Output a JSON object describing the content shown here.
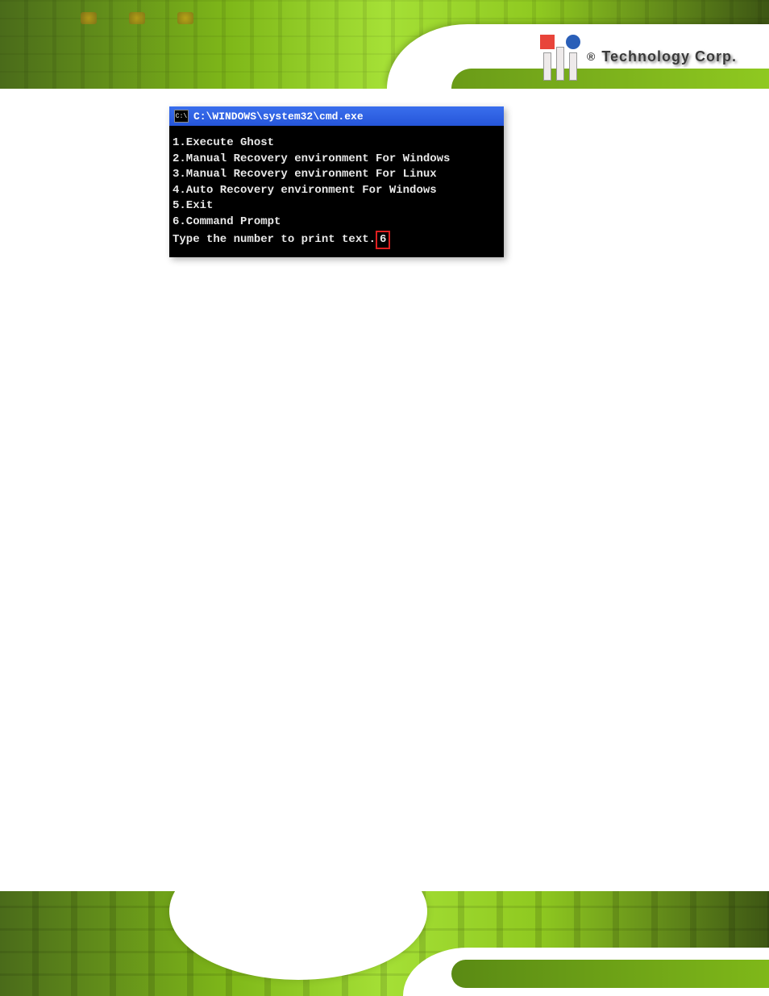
{
  "header": {
    "logo_registered": "®",
    "logo_text": "Technology Corp."
  },
  "cmd_window": {
    "icon_label": "C:\\",
    "title": "C:\\WINDOWS\\system32\\cmd.exe",
    "menu_items": [
      "1.Execute Ghost",
      "2.Manual Recovery environment For Windows",
      "3.Manual Recovery environment For Linux",
      "4.Auto Recovery environment For Windows",
      "5.Exit",
      "6.Command Prompt"
    ],
    "prompt_text": "Type the number to print text.",
    "prompt_input": "6"
  }
}
